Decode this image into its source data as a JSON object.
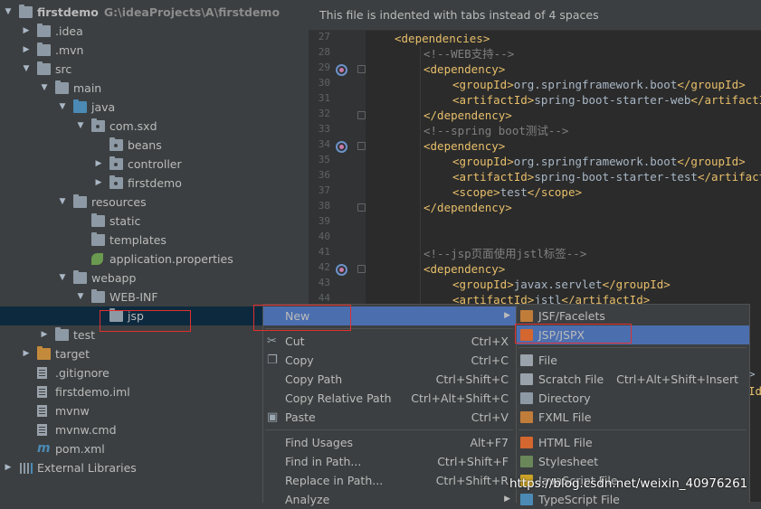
{
  "tree": {
    "project_name": "firstdemo",
    "project_path": "G:\\ideaProjects\\A\\firstdemo",
    "items": [
      {
        "label": "firstdemo",
        "depth": 0,
        "arrow": "▼",
        "icon": "folder-icon"
      },
      {
        "label": ".idea",
        "depth": 1,
        "arrow": "▶",
        "icon": "folder-icon"
      },
      {
        "label": ".mvn",
        "depth": 1,
        "arrow": "▶",
        "icon": "folder-icon"
      },
      {
        "label": "src",
        "depth": 1,
        "arrow": "▼",
        "icon": "folder-icon"
      },
      {
        "label": "main",
        "depth": 2,
        "arrow": "▼",
        "icon": "folder-icon"
      },
      {
        "label": "java",
        "depth": 3,
        "arrow": "▼",
        "icon": "source-folder-icon"
      },
      {
        "label": "com.sxd",
        "depth": 4,
        "arrow": "▼",
        "icon": "package-icon"
      },
      {
        "label": "beans",
        "depth": 5,
        "arrow": "",
        "icon": "package-icon"
      },
      {
        "label": "controller",
        "depth": 5,
        "arrow": "▶",
        "icon": "package-icon"
      },
      {
        "label": "firstdemo",
        "depth": 5,
        "arrow": "▶",
        "icon": "package-icon"
      },
      {
        "label": "resources",
        "depth": 3,
        "arrow": "▼",
        "icon": "resources-folder-icon"
      },
      {
        "label": "static",
        "depth": 4,
        "arrow": "",
        "icon": "folder-icon"
      },
      {
        "label": "templates",
        "depth": 4,
        "arrow": "",
        "icon": "folder-icon"
      },
      {
        "label": "application.properties",
        "depth": 4,
        "arrow": "",
        "icon": "spring-leaf-icon"
      },
      {
        "label": "webapp",
        "depth": 3,
        "arrow": "▼",
        "icon": "folder-icon"
      },
      {
        "label": "WEB-INF",
        "depth": 4,
        "arrow": "▼",
        "icon": "folder-icon"
      },
      {
        "label": "jsp",
        "depth": 5,
        "arrow": "",
        "icon": "folder-icon",
        "selected": true
      },
      {
        "label": "test",
        "depth": 2,
        "arrow": "▶",
        "icon": "folder-icon"
      },
      {
        "label": "target",
        "depth": 1,
        "arrow": "▶",
        "icon": "excluded-folder-icon"
      },
      {
        "label": ".gitignore",
        "depth": 1,
        "arrow": "",
        "icon": "text-file-icon"
      },
      {
        "label": "firstdemo.iml",
        "depth": 1,
        "arrow": "",
        "icon": "module-file-icon"
      },
      {
        "label": "mvnw",
        "depth": 1,
        "arrow": "",
        "icon": "text-file-icon"
      },
      {
        "label": "mvnw.cmd",
        "depth": 1,
        "arrow": "",
        "icon": "text-file-icon"
      },
      {
        "label": "pom.xml",
        "depth": 1,
        "arrow": "",
        "icon": "maven-icon"
      },
      {
        "label": "External Libraries",
        "depth": 0,
        "arrow": "▶",
        "icon": "libraries-icon"
      }
    ]
  },
  "editor": {
    "banner": "This file is indented with tabs instead of 4 spaces",
    "lines": [
      {
        "n": "27",
        "indent": 0,
        "parts": [
          [
            "tag",
            "<dependencies>"
          ]
        ]
      },
      {
        "n": "28",
        "indent": 1,
        "parts": [
          [
            "cmt",
            "<!--WEB支持-->"
          ]
        ]
      },
      {
        "n": "29",
        "indent": 1,
        "parts": [
          [
            "tag",
            "<dependency>"
          ]
        ],
        "mark": true
      },
      {
        "n": "30",
        "indent": 2,
        "parts": [
          [
            "tag",
            "<groupId>"
          ],
          [
            "txt",
            "org.springframework.boot"
          ],
          [
            "tag",
            "</groupId>"
          ]
        ]
      },
      {
        "n": "31",
        "indent": 2,
        "parts": [
          [
            "tag",
            "<artifactId>"
          ],
          [
            "txt",
            "spring-boot-starter-web"
          ],
          [
            "tag",
            "</artifactId>"
          ]
        ]
      },
      {
        "n": "32",
        "indent": 1,
        "parts": [
          [
            "tag",
            "</dependency>"
          ]
        ]
      },
      {
        "n": "33",
        "indent": 1,
        "parts": [
          [
            "cmt",
            "<!--spring boot测试-->"
          ]
        ]
      },
      {
        "n": "34",
        "indent": 1,
        "parts": [
          [
            "tag",
            "<dependency>"
          ]
        ],
        "mark": true
      },
      {
        "n": "35",
        "indent": 2,
        "parts": [
          [
            "tag",
            "<groupId>"
          ],
          [
            "txt",
            "org.springframework.boot"
          ],
          [
            "tag",
            "</groupId>"
          ]
        ]
      },
      {
        "n": "36",
        "indent": 2,
        "parts": [
          [
            "tag",
            "<artifactId>"
          ],
          [
            "txt",
            "spring-boot-starter-test"
          ],
          [
            "tag",
            "</artifactId>"
          ]
        ]
      },
      {
        "n": "37",
        "indent": 2,
        "parts": [
          [
            "tag",
            "<scope>"
          ],
          [
            "txt",
            "test"
          ],
          [
            "tag",
            "</scope>"
          ]
        ]
      },
      {
        "n": "38",
        "indent": 1,
        "parts": [
          [
            "tag",
            "</dependency>"
          ]
        ]
      },
      {
        "n": "39",
        "indent": 0,
        "parts": []
      },
      {
        "n": "40",
        "indent": 0,
        "parts": []
      },
      {
        "n": "41",
        "indent": 1,
        "parts": [
          [
            "cmt",
            "<!--jsp页面使用jstl标签-->"
          ]
        ]
      },
      {
        "n": "42",
        "indent": 1,
        "parts": [
          [
            "tag",
            "<dependency>"
          ]
        ],
        "mark": true
      },
      {
        "n": "43",
        "indent": 2,
        "parts": [
          [
            "tag",
            "<groupId>"
          ],
          [
            "txt",
            "javax.servlet"
          ],
          [
            "tag",
            "</groupId>"
          ]
        ]
      },
      {
        "n": "44",
        "indent": 2,
        "parts": [
          [
            "tag",
            "<artifactId>"
          ],
          [
            "txt",
            "jstl"
          ],
          [
            "tag",
            "</artifactId>"
          ]
        ]
      }
    ],
    "tail_fragments": [
      ">",
      "Id"
    ]
  },
  "context_menu": {
    "items": [
      {
        "label": "New",
        "shortcut": "",
        "submenu": true,
        "selected": true
      },
      {
        "sep": true
      },
      {
        "label": "Cut",
        "shortcut": "Ctrl+X",
        "icon": "scissors-icon"
      },
      {
        "label": "Copy",
        "shortcut": "Ctrl+C",
        "icon": "copy-icon"
      },
      {
        "label": "Copy Path",
        "shortcut": "Ctrl+Shift+C"
      },
      {
        "label": "Copy Relative Path",
        "shortcut": "Ctrl+Alt+Shift+C"
      },
      {
        "label": "Paste",
        "shortcut": "Ctrl+V",
        "icon": "paste-icon"
      },
      {
        "sep": true
      },
      {
        "label": "Find Usages",
        "shortcut": "Alt+F7"
      },
      {
        "label": "Find in Path...",
        "shortcut": "Ctrl+Shift+F"
      },
      {
        "label": "Replace in Path...",
        "shortcut": "Ctrl+Shift+R"
      },
      {
        "label": "Analyze",
        "shortcut": "",
        "submenu": true
      }
    ]
  },
  "submenu": {
    "items": [
      {
        "label": "JSF/Facelets",
        "shortcut": "",
        "icon": "jsf-icon"
      },
      {
        "label": "JSP/JSPX",
        "shortcut": "",
        "icon": "jsp-icon",
        "selected": true
      },
      {
        "sep": true
      },
      {
        "label": "File",
        "shortcut": "",
        "icon": "file-icon"
      },
      {
        "label": "Scratch File",
        "shortcut": "Ctrl+Alt+Shift+Insert",
        "icon": "scratch-file-icon"
      },
      {
        "label": "Directory",
        "shortcut": "",
        "icon": "directory-icon"
      },
      {
        "label": "FXML File",
        "shortcut": "",
        "icon": "fxml-icon"
      },
      {
        "sep": true
      },
      {
        "label": "HTML File",
        "shortcut": "",
        "icon": "html-icon"
      },
      {
        "label": "Stylesheet",
        "shortcut": "",
        "icon": "css-icon"
      },
      {
        "label": "JavaScript File",
        "shortcut": "",
        "icon": "javascript-icon"
      },
      {
        "label": "TypeScript File",
        "shortcut": "",
        "icon": "typescript-icon"
      }
    ]
  },
  "colors": {
    "selection": "#4b6eaf",
    "tree_selection": "#0d293e",
    "highlight_box": "#e0302e",
    "xml_tag": "#e8bf6a",
    "comment": "#808080"
  },
  "watermark": "https://blog.csdn.net/weixin_40976261"
}
